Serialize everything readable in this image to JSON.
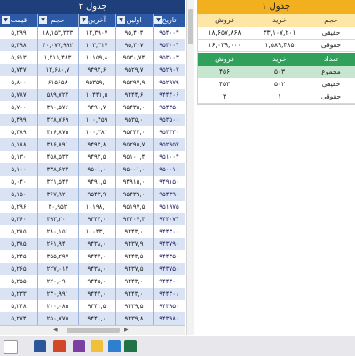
{
  "table2": {
    "title": "جدول ۲",
    "columns": [
      "قیمت",
      "حجم",
      "آخرین",
      "اولین",
      "تاریخ"
    ],
    "rows": [
      [
        "۵,۲۹۹",
        "۱۸,۱۵۳,۳۳۳",
        "۱۲,۳۹۰۷",
        "۹۵,۴۰۴",
        "۹۵۴۰۰۴"
      ],
      [
        "۵,۴۹۸",
        "۴۰,۰۷۷,۹۹۲",
        "۱۰۳,۳۱۷",
        "۹۵,۳۰۷",
        "۹۵۳۰۰۴"
      ],
      [
        "۵,۶۱۳",
        "۱,۲۱۱,۴۸۳",
        "۱۰۱۵۹,۸",
        "۹۵۳۰,۷۴",
        "۹۵۳۰۰۳"
      ],
      [
        "۵,۷۴۷",
        "۱۲,۶۸۰,۷",
        "۹۴۹۲,۶",
        "۹۵۲۹,۷",
        "۹۵۲۹۰۷"
      ],
      [
        "۵,۸۰۰",
        "۶۱۵۶۵۸",
        "۹۵۳۵۹,۰",
        "۹۵۲۹۷,۹",
        "۹۵۲۹۷۹"
      ],
      [
        "۵,۷۸۷",
        "۵۸۹,۷۲۲",
        "۱۰۴۴۱,۵",
        "۹۴۴۴,۶",
        "۹۴۴۴۰۶"
      ],
      [
        "۵,۷۰۰",
        "۳۹۰,۵۷۶",
        "۹۴۹۱,۷",
        "۹۵۴۳۵,۰",
        "۹۵۴۳۵۰"
      ],
      [
        "۵,۴۹۹",
        "۴۲۸,۷۶۹",
        "۱۰۰,۴۵۹",
        "۹۵۳۵,۰",
        "۹۵۳۵۰۰"
      ],
      [
        "۵,۴۸۹",
        "۴۱۶,۸۷۵",
        "۱۰۰,۳۸۱",
        "۹۵۴۴۳,۰",
        "۹۵۴۴۳۰"
      ],
      [
        "۵,۱۸۸",
        "۳۸۶,۸۹۱",
        "۹۴۹۲,۸",
        "۹۵۲۹۵,۷",
        "۹۵۲۹۵۷"
      ],
      [
        "۵,۱۳۰",
        "۴۵۸,۵۳۳",
        "۹۴۹۲,۵",
        "۹۵۱۰۰,۴",
        "۹۵۱۰۰۴"
      ],
      [
        "۵,۱۰۰",
        "۳۳۸,۶۲۲",
        "۹۵۰۱,۰",
        "۹۵۰۰۱,۰",
        "۹۵۰۰۱۰"
      ],
      [
        "۵,۰۴۰",
        "۳۲۱,۵۴۴",
        "۹۴۹۱,۵",
        "۹۴۹۱۵,۰",
        "۹۴۹۱۵۰"
      ],
      [
        "۵,۱۵۰",
        "۳۶۷,۹۲۰",
        "۹۵۴۳,۹",
        "۹۵۴۳۹,۰",
        "۹۵۴۳۹۰"
      ],
      [
        "۵,۲۹۶",
        "۳۰,۹۵۲",
        "۱۰۱۹۸,۰",
        "۹۵۱۹۷,۵",
        "۹۵۱۹۷۵"
      ],
      [
        "۵,۳۶۰",
        "۴۹۳,۲۰۰",
        "۹۴۴۴,۰",
        "۹۴۴۰۷,۴",
        "۹۴۴۰۷۴"
      ],
      [
        "۵,۲۸۵",
        "۲۸۰,۱۵۱",
        "۱۰۰۴۳,۰",
        "۹۴۴۳,۰",
        "۹۴۴۳۰۰"
      ],
      [
        "۵,۳۸۵",
        "۲۶۱,۹۴۰",
        "۹۴۳۸,۰",
        "۹۴۳۷,۹",
        "۹۴۳۷۹۰"
      ],
      [
        "۵,۲۴۵",
        "۳۵۵,۲۹۷",
        "۹۴۴۴,۰",
        "۹۴۴۳,۵",
        "۹۴۴۳۵۰"
      ],
      [
        "۵,۲۶۵",
        "۲۲۷,۰۱۴",
        "۹۴۳۸,۰",
        "۹۴۳۷,۵",
        "۹۴۳۷۵۰"
      ],
      [
        "۵,۲۵۵",
        "۲۲۰,۰۹۰",
        "۹۴۴۵,۰",
        "۹۴۴۳,۰",
        "۹۴۴۳۰۰"
      ],
      [
        "۵,۲۳۳",
        "۲۳۰,۹۹۱",
        "۹۴۴۴,۰",
        "۹۴۴۳,۰",
        "۹۴۴۳۰۱"
      ],
      [
        "۵,۲۴۸",
        "۲۰۰,۰۸۵",
        "۹۴۴۱,۵",
        "۹۴۳۹,۵",
        "۹۴۳۹۵۰"
      ],
      [
        "۵,۲۷۴",
        "۲۵۰,۷۷۵",
        "۹۴۴۱,۰",
        "۹۴۳۹,۸",
        "۹۴۳۹۸۰"
      ]
    ]
  },
  "table1": {
    "title": "جدول ۱",
    "columns": [
      "فروش",
      "خرید",
      "حجم"
    ],
    "rows": [
      [
        "۱۸,۶۵۷,۸۶۸",
        "۳۳,۱۰۷,۲۰۱",
        "حقیقی"
      ],
      [
        "۱۶,۰۳۹,۰۰۰",
        "۱,۵۸۹,۴۸۵",
        "حقوقی"
      ]
    ],
    "count_columns": [
      "فروش",
      "خرید",
      "تعداد"
    ],
    "count_sum": [
      "۴۵۶",
      "۵۰۳",
      "مجموع"
    ],
    "count_rows": [
      [
        "۴۵۳",
        "۵۰۲",
        "حقیقی"
      ],
      [
        "۳",
        "۱",
        "حقوقی"
      ]
    ]
  },
  "taskbar": {
    "icons": [
      "file-icon",
      "word-icon",
      "powerpoint-icon",
      "app-icon",
      "image-icon",
      "photos-icon",
      "excel-icon"
    ]
  },
  "colors": {
    "table2_title": "#1f3f7a",
    "table2_header": "#2c5aa6",
    "table2_band": "#dae3f3",
    "table1_title": "#f2b01e",
    "table1_header": "#fde6a6",
    "count_header": "#2fa15a",
    "count_sum": "#c7e6cf"
  }
}
